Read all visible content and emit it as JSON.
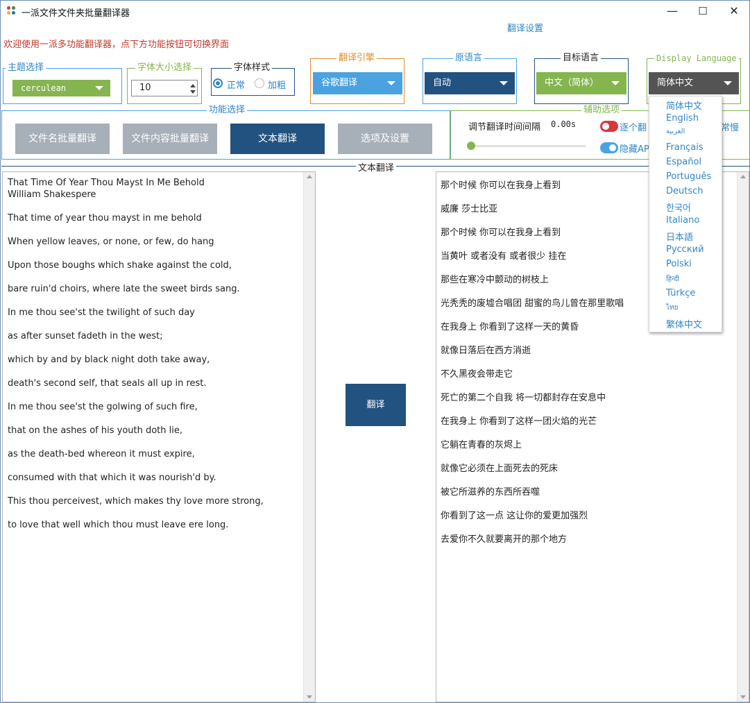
{
  "window": {
    "title": "一派文件文件夹批量翻译器",
    "minimize_glyph": "—",
    "maximize_glyph": "☐",
    "close_glyph": "✕"
  },
  "welcome_text": "欢迎使用一派多功能翻译器，点下方功能按钮可切换界面",
  "settings_title": "翻译设置",
  "theme": {
    "legend": "主题选择",
    "value": "cerculean"
  },
  "font_size": {
    "legend": "字体大小选择",
    "value": "10"
  },
  "font_style": {
    "legend": "字体样式",
    "normal": "正常",
    "bold": "加粗"
  },
  "engine": {
    "legend": "翻译引擎",
    "value": "谷歌翻译"
  },
  "source_lang": {
    "legend": "原语言",
    "value": "自动"
  },
  "target_lang": {
    "legend": "目标语言",
    "value": "中文（简体）"
  },
  "display_lang": {
    "legend": "Display Language",
    "value": "简体中文",
    "options": [
      "简体中文",
      "English",
      "العربية",
      "Français",
      "Español",
      "Português",
      "Deutsch",
      "한국어",
      "Italiano",
      "日本語",
      "Русский",
      "Polski",
      "हिन्दी",
      "Türkçe",
      "ไทย",
      "繁体中文"
    ]
  },
  "functions": {
    "legend": "功能选择",
    "buttons": [
      "文件名批量翻译",
      "文件内容批量翻译",
      "文本翻译",
      "选项及设置"
    ]
  },
  "aux": {
    "legend": "辅助选项",
    "interval_label": "调节翻译时间间隔",
    "interval_value": "0.00s",
    "toggle1_label": "逐个翻",
    "toggle2_label": "隐藏API",
    "slow_label": "常慢"
  },
  "text_translate": {
    "legend": "文本翻译",
    "translate_button": "翻译",
    "source_lines": [
      "That Time Of Year Thou Mayst In Me Behold",
      "William Shakespere",
      "That time of year thou mayst in me behold",
      "When yellow leaves, or none, or few, do hang",
      "Upon those boughs which shake against the cold,",
      "bare ruin'd choirs, where late the sweet birds sang.",
      "In me thou see'st the twilight of such day",
      "as after sunset fadeth in the west;",
      "which by and by black night doth take away,",
      "death's second self, that seals all up in rest.",
      "In me thou see'st the golwing of such fire,",
      "that on the ashes of his youth doth lie,",
      "as the death-bed whereon it must expire,",
      "consumed with that which it was nourish'd by.",
      "This thou perceivest, which makes thy love more strong,",
      "to love that well which thou must leave ere long."
    ],
    "target_lines": [
      "那个时候 你可以在我身上看到",
      "威廉 莎士比亚",
      "那个时候 你可以在我身上看到",
      "当黄叶 或者没有 或者很少 挂在",
      "那些在寒冷中颤动的树枝上",
      "光秃秃的废墟合唱团 甜蜜的鸟儿曾在那里歌唱",
      "在我身上 你看到了这样一天的黄昏",
      "就像日落后在西方消逝",
      "不久黑夜会带走它",
      "死亡的第二个自我 将一切都封存在安息中",
      "在我身上 你看到了这样一团火焰的光芒",
      "它躺在青春的灰烬上",
      "就像它必须在上面死去的死床",
      "被它所滋养的东西所吞噬",
      "你看到了这一点 这让你的爱更加强烈",
      "去爱你不久就要离开的那个地方"
    ]
  },
  "colors": {
    "accent_green": "#84b54f",
    "accent_blue": "#4aa3df",
    "navy": "#22527f",
    "gray_button": "#a7afb8",
    "dark_combo": "#545454",
    "toggle_red": "#d9383a"
  }
}
